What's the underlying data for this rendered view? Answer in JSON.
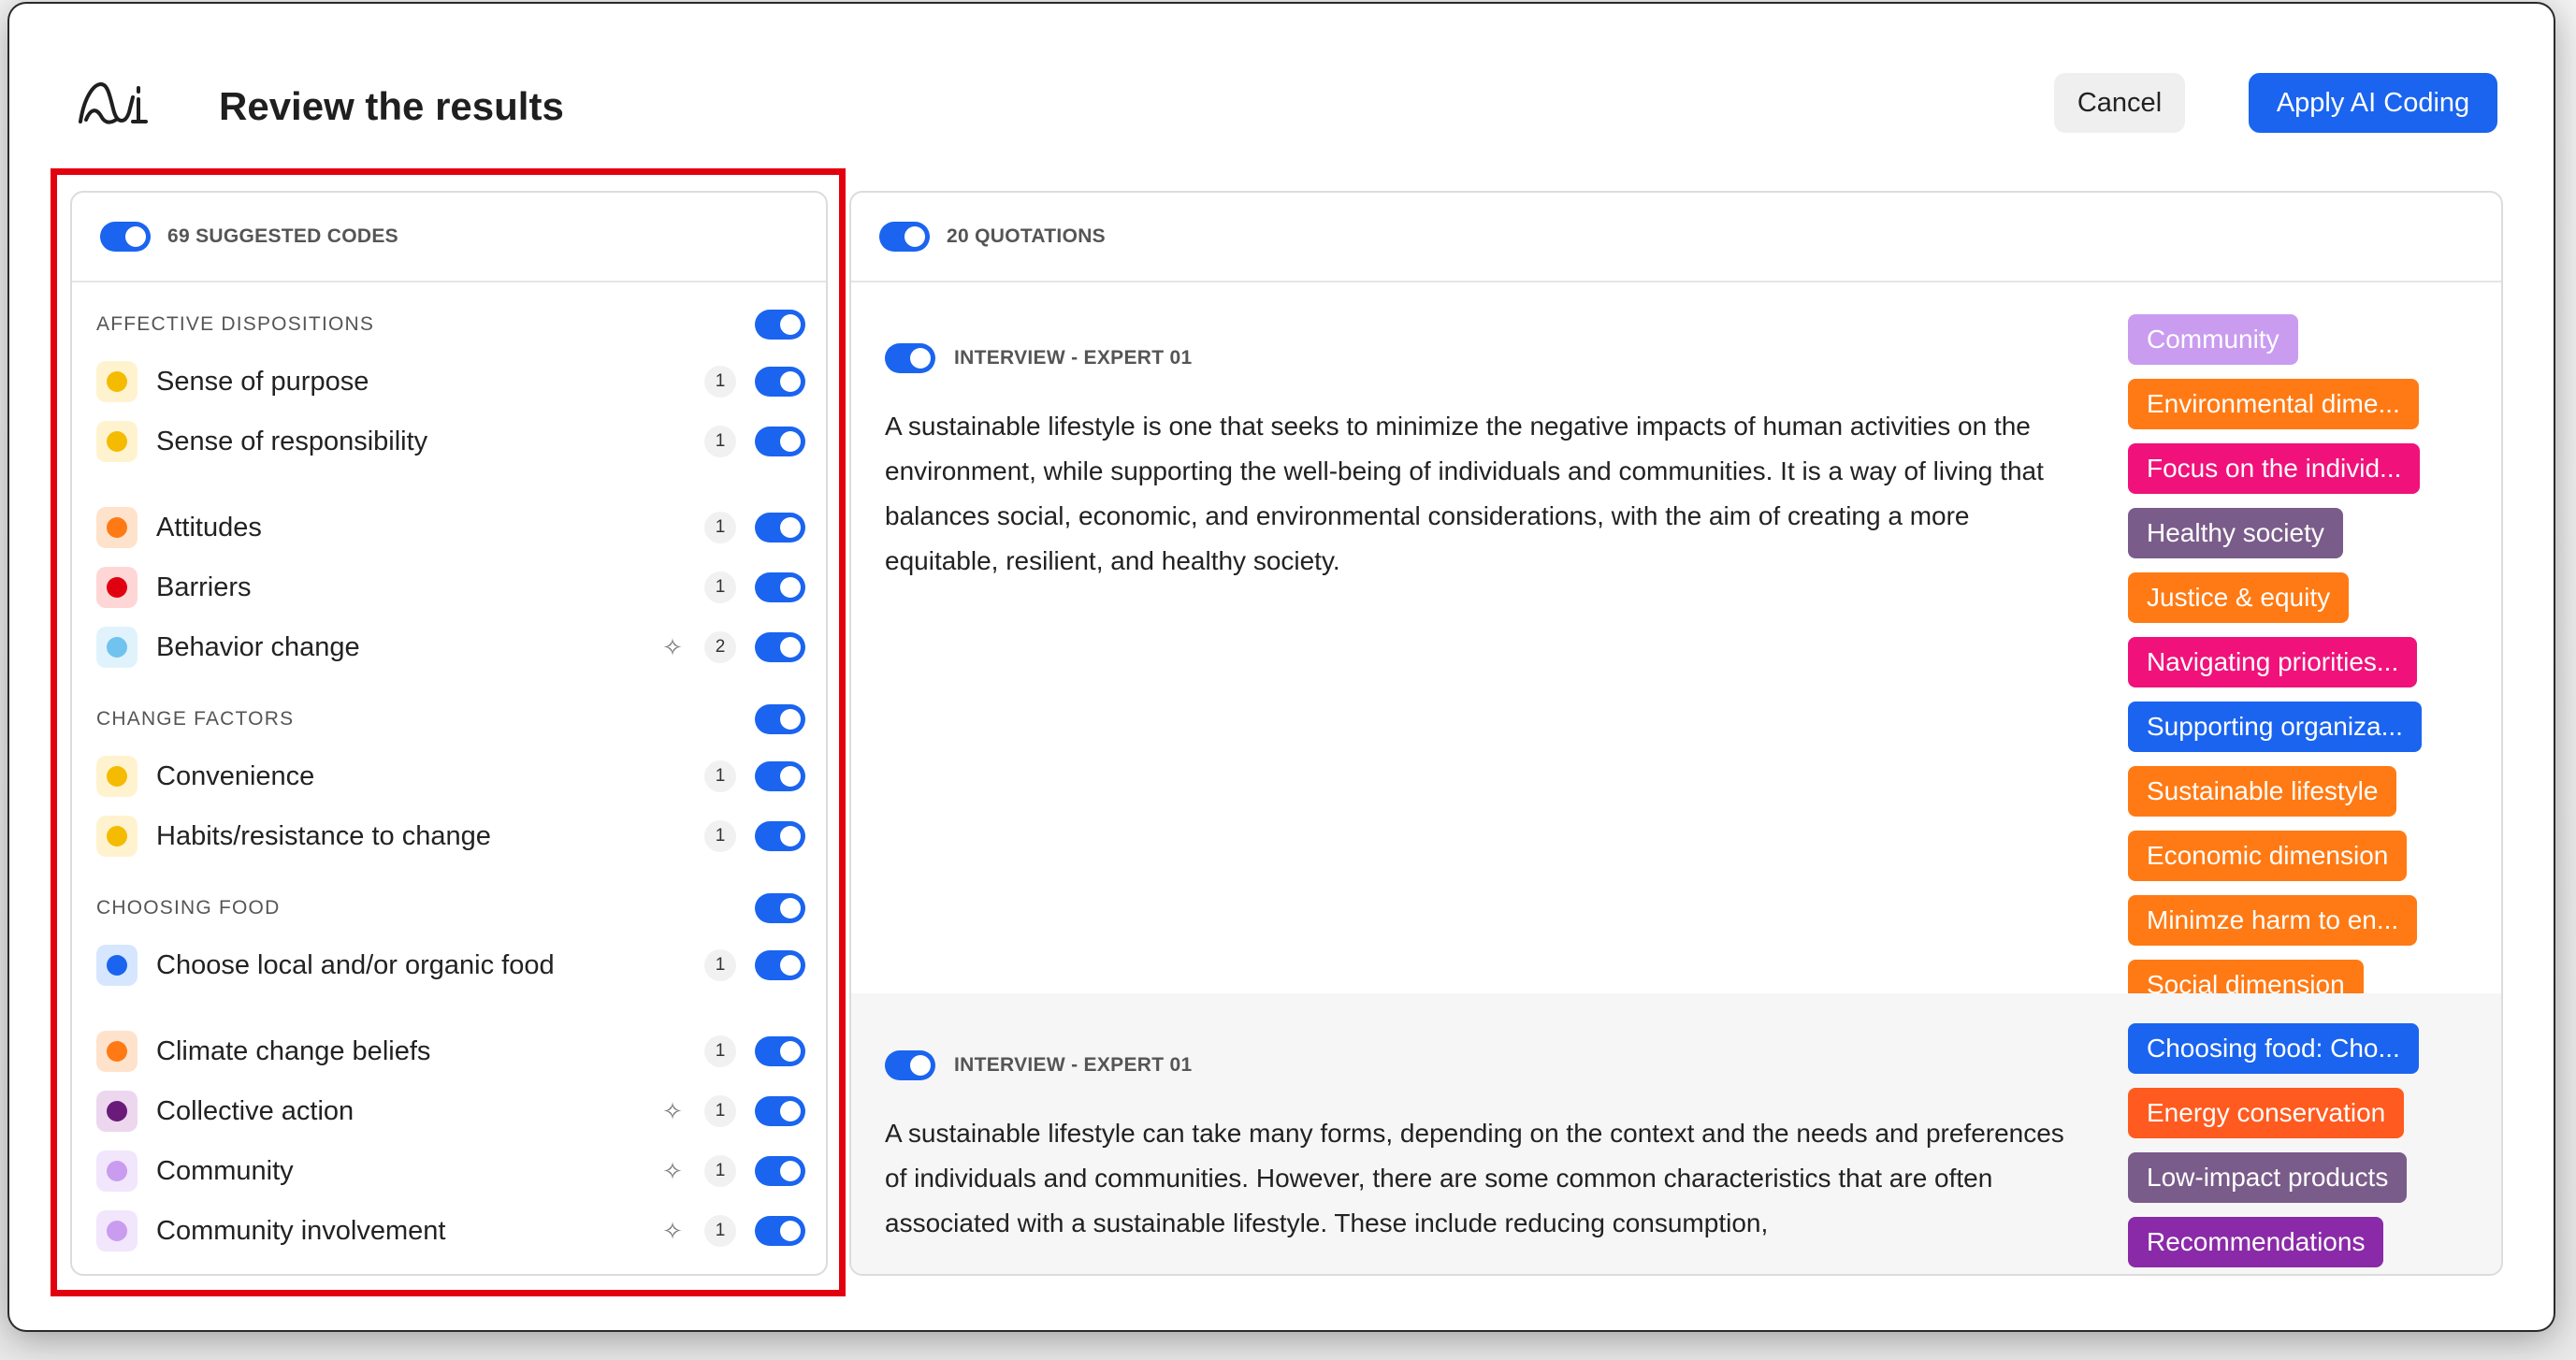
{
  "title": "Review the results",
  "buttons": {
    "cancel": "Cancel",
    "apply": "Apply AI Coding"
  },
  "left": {
    "header": "69 SUGGESTED CODES",
    "groups": [
      {
        "label": "AFFECTIVE DISPOSITIONS",
        "codes": [
          {
            "label": "Sense of purpose",
            "count": "1",
            "dot": "#f5bb00",
            "bg": "#fff3cf",
            "ai": false
          },
          {
            "label": "Sense of responsibility",
            "count": "1",
            "dot": "#f5bb00",
            "bg": "#fff3cf",
            "ai": false
          }
        ]
      }
    ],
    "ungrouped1": [
      {
        "label": "Attitudes",
        "count": "1",
        "dot": "#ff7a14",
        "bg": "#ffe2cc",
        "ai": false
      },
      {
        "label": "Barriers",
        "count": "1",
        "dot": "#e0000f",
        "bg": "#ffd6d6",
        "ai": false
      },
      {
        "label": "Behavior change",
        "count": "2",
        "dot": "#6fc3ee",
        "bg": "#e0f3fc",
        "ai": true
      }
    ],
    "group2": {
      "label": "CHANGE FACTORS",
      "codes": [
        {
          "label": "Convenience",
          "count": "1",
          "dot": "#f5bb00",
          "bg": "#fff3cf",
          "ai": false
        },
        {
          "label": "Habits/resistance to change",
          "count": "1",
          "dot": "#f5bb00",
          "bg": "#fff3cf",
          "ai": false
        }
      ]
    },
    "group3": {
      "label": "CHOOSING FOOD",
      "codes": [
        {
          "label": "Choose local and/or organic food",
          "count": "1",
          "dot": "#1a64f0",
          "bg": "#d6e6ff",
          "ai": false
        }
      ]
    },
    "ungrouped2": [
      {
        "label": "Climate change beliefs",
        "count": "1",
        "dot": "#ff7a14",
        "bg": "#ffe2cc",
        "ai": false
      },
      {
        "label": "Collective action",
        "count": "1",
        "dot": "#6a1b7a",
        "bg": "#ecd7ef",
        "ai": true
      },
      {
        "label": "Community",
        "count": "1",
        "dot": "#c99cf0",
        "bg": "#f1e6fb",
        "ai": true
      },
      {
        "label": "Community involvement",
        "count": "1",
        "dot": "#c99cf0",
        "bg": "#f1e6fb",
        "ai": true
      }
    ]
  },
  "right": {
    "header": "20 QUOTATIONS",
    "quotes": [
      {
        "source": "INTERVIEW - EXPERT 01",
        "text": "A sustainable lifestyle is one that seeks to minimize the negative impacts of human activities on the environment, while supporting the well-being of individuals and communities. It is a way of living that balances social, economic, and environmental considerations, with the aim of creating a more equitable, resilient, and healthy society.",
        "chips": [
          {
            "label": "Community",
            "color": "#c99cf0"
          },
          {
            "label": "Environmental dime...",
            "color": "#ff7a14"
          },
          {
            "label": "Focus on the individ...",
            "color": "#f0127a"
          },
          {
            "label": "Healthy society",
            "color": "#7a5c8a"
          },
          {
            "label": "Justice & equity",
            "color": "#ff7a14"
          },
          {
            "label": "Navigating priorities...",
            "color": "#f0127a"
          },
          {
            "label": "Supporting organiza...",
            "color": "#1a64f0"
          },
          {
            "label": "Sustainable lifestyle",
            "color": "#ff7a14"
          },
          {
            "label": "Economic dimension",
            "color": "#ff7a14"
          },
          {
            "label": "Minimze harm to en...",
            "color": "#ff7a14"
          },
          {
            "label": "Social dimension",
            "color": "#ff7a14"
          }
        ]
      },
      {
        "source": "INTERVIEW - EXPERT 01",
        "text": "A sustainable lifestyle can take many forms, depending on the context and the needs and preferences of individuals and communities. However, there are some common characteristics that are often associated with a sustainable lifestyle. These include reducing consumption,",
        "chips": [
          {
            "label": "Choosing food: Cho...",
            "color": "#1a64f0"
          },
          {
            "label": "Energy conservation",
            "color": "#ff5a1f"
          },
          {
            "label": "Low-impact products",
            "color": "#7a5c8a"
          },
          {
            "label": "Recommendations",
            "color": "#8a2aa8"
          }
        ]
      }
    ]
  }
}
